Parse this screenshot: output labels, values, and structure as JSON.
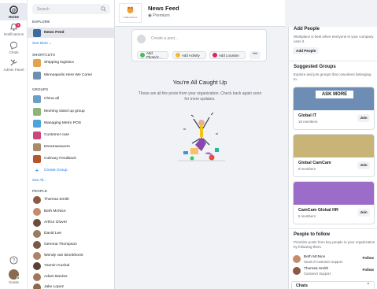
{
  "rail": {
    "items": [
      {
        "label": "Home",
        "icon": "workplace-logo-icon"
      },
      {
        "label": "Notifications",
        "icon": "bell-icon",
        "badge": "3"
      },
      {
        "label": "Chats",
        "icon": "chat-icon"
      },
      {
        "label": "Admin Panel",
        "icon": "wrench-icon"
      }
    ],
    "help_icon": "help-icon",
    "user_name": "Gnatis"
  },
  "sidebar": {
    "search_placeholder": "Search",
    "explore_heading": "EXPLORE",
    "news_feed": "News Feed",
    "see_more": "See More",
    "shortcuts_heading": "SHORTCUTS",
    "shortcuts": [
      {
        "label": "Shipping logistics",
        "color": "#e4a34a"
      },
      {
        "label": "Minneapolis Here We Come",
        "color": "#6f8fb0"
      }
    ],
    "groups_heading": "GROUPS",
    "groups": [
      {
        "label": "China all",
        "color": "#6aa0c8"
      },
      {
        "label": "Morning stand up group",
        "color": "#8bb37a"
      },
      {
        "label": "Managing Metro POS",
        "color": "#4fa3d9"
      },
      {
        "label": "Customer care",
        "color": "#c9497a"
      },
      {
        "label": "Dreamweavers",
        "color": "#a88b6a"
      },
      {
        "label": "Culinary Feedback",
        "color": "#b5562e"
      }
    ],
    "create_group": "Create Group",
    "see_all": "See All...",
    "people_heading": "PEOPLE",
    "people": [
      {
        "name": "Theresa Smith",
        "color": "#8a5a44"
      },
      {
        "name": "Beth McNice",
        "color": "#c58c6b"
      },
      {
        "name": "Arthur Glover",
        "color": "#6d4c3d"
      },
      {
        "name": "David Lee",
        "color": "#9b7b62"
      },
      {
        "name": "Gemma Thompson",
        "color": "#7a5747"
      },
      {
        "name": "Wendy van Bronkhorst",
        "color": "#b08067"
      },
      {
        "name": "Yasmin Kushal",
        "color": "#5e3f33"
      },
      {
        "name": "Adam Bardos",
        "color": "#a2775c"
      },
      {
        "name": "Jake Lopez",
        "color": "#8b6a4e"
      }
    ]
  },
  "header": {
    "title": "News Feed",
    "subtitle": "Premium",
    "logo_text": "CamCam Ltd."
  },
  "composer": {
    "placeholder": "Create a post...",
    "buttons": [
      {
        "label": "Add Photo/V...",
        "color": "#45bd62"
      },
      {
        "label": "Add Activity",
        "color": "#f7b928"
      },
      {
        "label": "Add Location",
        "color": "#e0245e"
      }
    ],
    "more": "•••"
  },
  "feed": {
    "caught_title": "You're All Caught Up",
    "caught_sub": "Those are all the posts from your organization. Check back again soon for more updates."
  },
  "right": {
    "add_people_title": "Add People",
    "add_people_text": "Workplace is best when everyone in your company uses it.",
    "add_people_button": "Add People",
    "suggested_title": "Suggested Groups",
    "suggested_text": "Explore and join groups that coworkers belonging to.",
    "groups": [
      {
        "name": "Global IT",
        "members": "15 members",
        "join": "Join",
        "color": "#6d8db5"
      },
      {
        "name": "Global CamCam",
        "members": "8 members",
        "join": "Join",
        "color": "#c8b476"
      },
      {
        "name": "CamCam Global HR",
        "members": "5 members",
        "join": "Join",
        "color": "#9b6cc8"
      }
    ],
    "people_title": "People to follow",
    "people_text": "Prioritize posts from key people in your organization by following them.",
    "people": [
      {
        "name": "Beth McNice",
        "role": "Head of Customer support",
        "follow": "Follow",
        "color": "#c58c6b"
      },
      {
        "name": "Theresa Smith",
        "role": "Customer Support",
        "follow": "Follow",
        "color": "#8a5a44"
      }
    ]
  },
  "chats_bar": {
    "label": "Chats"
  }
}
